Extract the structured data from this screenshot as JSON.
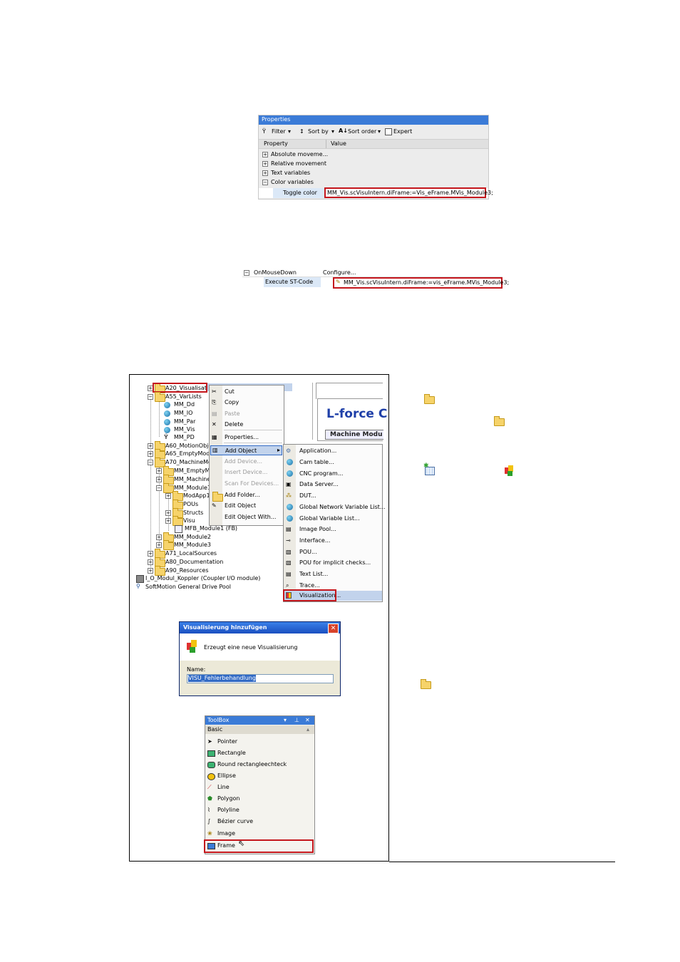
{
  "properties": {
    "title": "Properties",
    "toolbar": {
      "filter": "Filter",
      "sort_by": "Sort by",
      "sort_order": "Sort order",
      "expert": "Expert"
    },
    "columns": {
      "property": "Property",
      "value": "Value"
    },
    "rows": [
      "Absolute moveme...",
      "Relative movement",
      "Text variables",
      "Color variables"
    ],
    "toggle_label": "Toggle color",
    "toggle_value": "MM_Vis.scVisuIntern.diFrame:=Vis_eFrame.MVis_Module3;"
  },
  "event": {
    "name": "OnMouseDown",
    "value": "Configure...",
    "action": "Execute ST-Code",
    "code": "MM_Vis.scVisuIntern.diFrame:=vis_eFrame.MVis_Module3;"
  },
  "tree": {
    "items": [
      "A20_Visualisation",
      "A55_VarLists",
      "MM_Dd",
      "MM_IO",
      "MM_Par",
      "MM_Vis",
      "MM_PD",
      "A60_MotionObject",
      "A65_EmptyModule",
      "A70_MachineModu",
      "MM_EmptyMod",
      "MM_Machine",
      "MM_Module1",
      "ModApp1",
      "POUs",
      "Structs",
      "Visu",
      "MFB_Module1 (FB)",
      "MM_Module2",
      "MM_Module3",
      "A71_LocalSources",
      "A80_Documentation",
      "A90_Resources",
      "I_O_Modul_Koppler (Coupler I/O module)",
      "SoftMotion General Drive Pool"
    ]
  },
  "context_menu": {
    "items": [
      "Cut",
      "Copy",
      "Paste",
      "Delete",
      "Properties...",
      "Add Object",
      "Add Device...",
      "Insert Device...",
      "Scan For Devices...",
      "Add Folder...",
      "Edit Object",
      "Edit Object With..."
    ]
  },
  "submenu": {
    "items": [
      "Application...",
      "Cam table...",
      "CNC program...",
      "Data Server...",
      "DUT...",
      "Global Network Variable List...",
      "Global Variable List...",
      "Image Pool...",
      "Interface...",
      "POU...",
      "POU for implicit checks...",
      "Text List...",
      "Trace...",
      "Visualization..."
    ]
  },
  "preview": {
    "title": "L-force C",
    "subtitle": "Machine Modu"
  },
  "dialog": {
    "title": "Visualisierung hinzufügen",
    "description": "Erzeugt eine neue Visualisierung",
    "name_label": "Name:",
    "name_value": "VISU_Fehlerbehandlung"
  },
  "toolbox": {
    "title": "ToolBox",
    "section": "Basic",
    "items": [
      "Pointer",
      "Rectangle",
      "Round rectangleechteck",
      "Ellipse",
      "Line",
      "Polygon",
      "Polyline",
      "Bézier curve",
      "Image",
      "Frame"
    ]
  },
  "colors": {
    "accent": "#3b7bd7",
    "highlight": "#c4161c",
    "selection": "#316ac5"
  }
}
